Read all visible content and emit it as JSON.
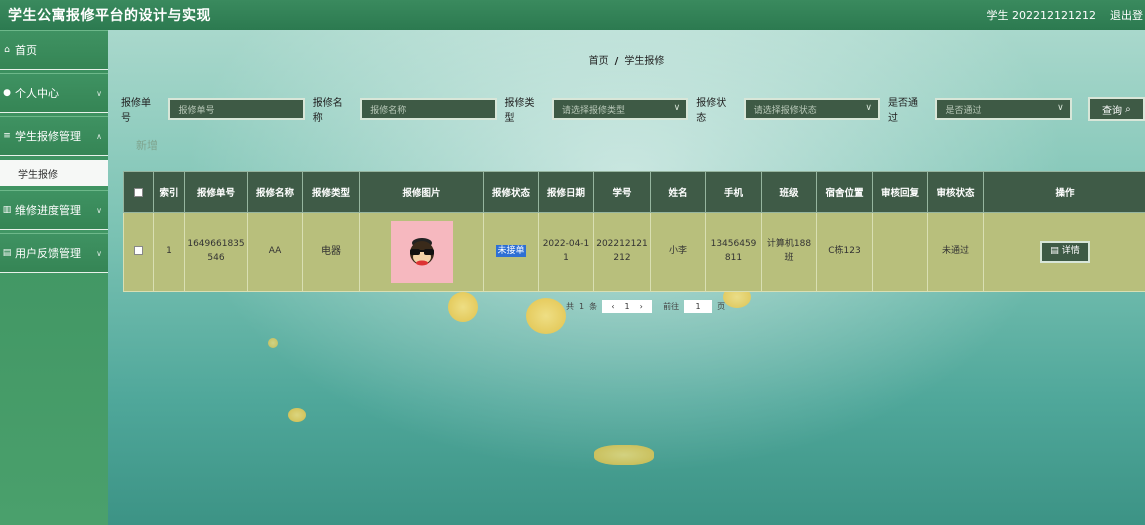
{
  "header": {
    "title": "学生公寓报修平台的设计与实现",
    "user_role": "学生",
    "user_id": "202212121212",
    "logout_label": "退出登"
  },
  "sidebar": {
    "items": [
      {
        "icon": "home-icon",
        "label": "首页"
      },
      {
        "icon": "user-icon",
        "label": "个人中心"
      },
      {
        "icon": "list-icon",
        "label": "学生报修管理"
      },
      {
        "icon": "chart-icon",
        "label": "维修进度管理"
      },
      {
        "icon": "doc-icon",
        "label": "用户反馈管理"
      }
    ],
    "sub_item": "学生报修"
  },
  "breadcrumb": {
    "home": "首页",
    "separator": "/",
    "current": "学生报修"
  },
  "filters": {
    "order_no": {
      "label": "报修单号",
      "placeholder": "报修单号"
    },
    "name": {
      "label": "报修名称",
      "placeholder": "报修名称"
    },
    "type": {
      "label": "报修类型",
      "placeholder": "请选择报修类型"
    },
    "status": {
      "label": "报修状态",
      "placeholder": "请选择报修状态"
    },
    "approved": {
      "label": "是否通过",
      "placeholder": "是否通过"
    },
    "search_label": "查询"
  },
  "add_label": "新增",
  "table": {
    "headers": [
      "索引",
      "报修单号",
      "报修名称",
      "报修类型",
      "报修图片",
      "报修状态",
      "报修日期",
      "学号",
      "姓名",
      "手机",
      "班级",
      "宿舍位置",
      "审核回复",
      "审核状态",
      "操作"
    ],
    "row": {
      "index": "1",
      "order_no": "1649661835546",
      "name": "AA",
      "type": "电器",
      "status": "未接单",
      "date": "2022-04-11",
      "student_no": "202212121212",
      "student_name": "小李",
      "phone": "13456459811",
      "class": "计算机188班",
      "dorm": "C栋123",
      "review_reply": "",
      "review_status": "未通过",
      "action_label": "详情"
    }
  },
  "pagination": {
    "total_prefix": "共",
    "total": "1",
    "total_suffix": "条",
    "page": "1",
    "goto_label": "前往",
    "goto_page": "1",
    "page_unit": "页"
  }
}
